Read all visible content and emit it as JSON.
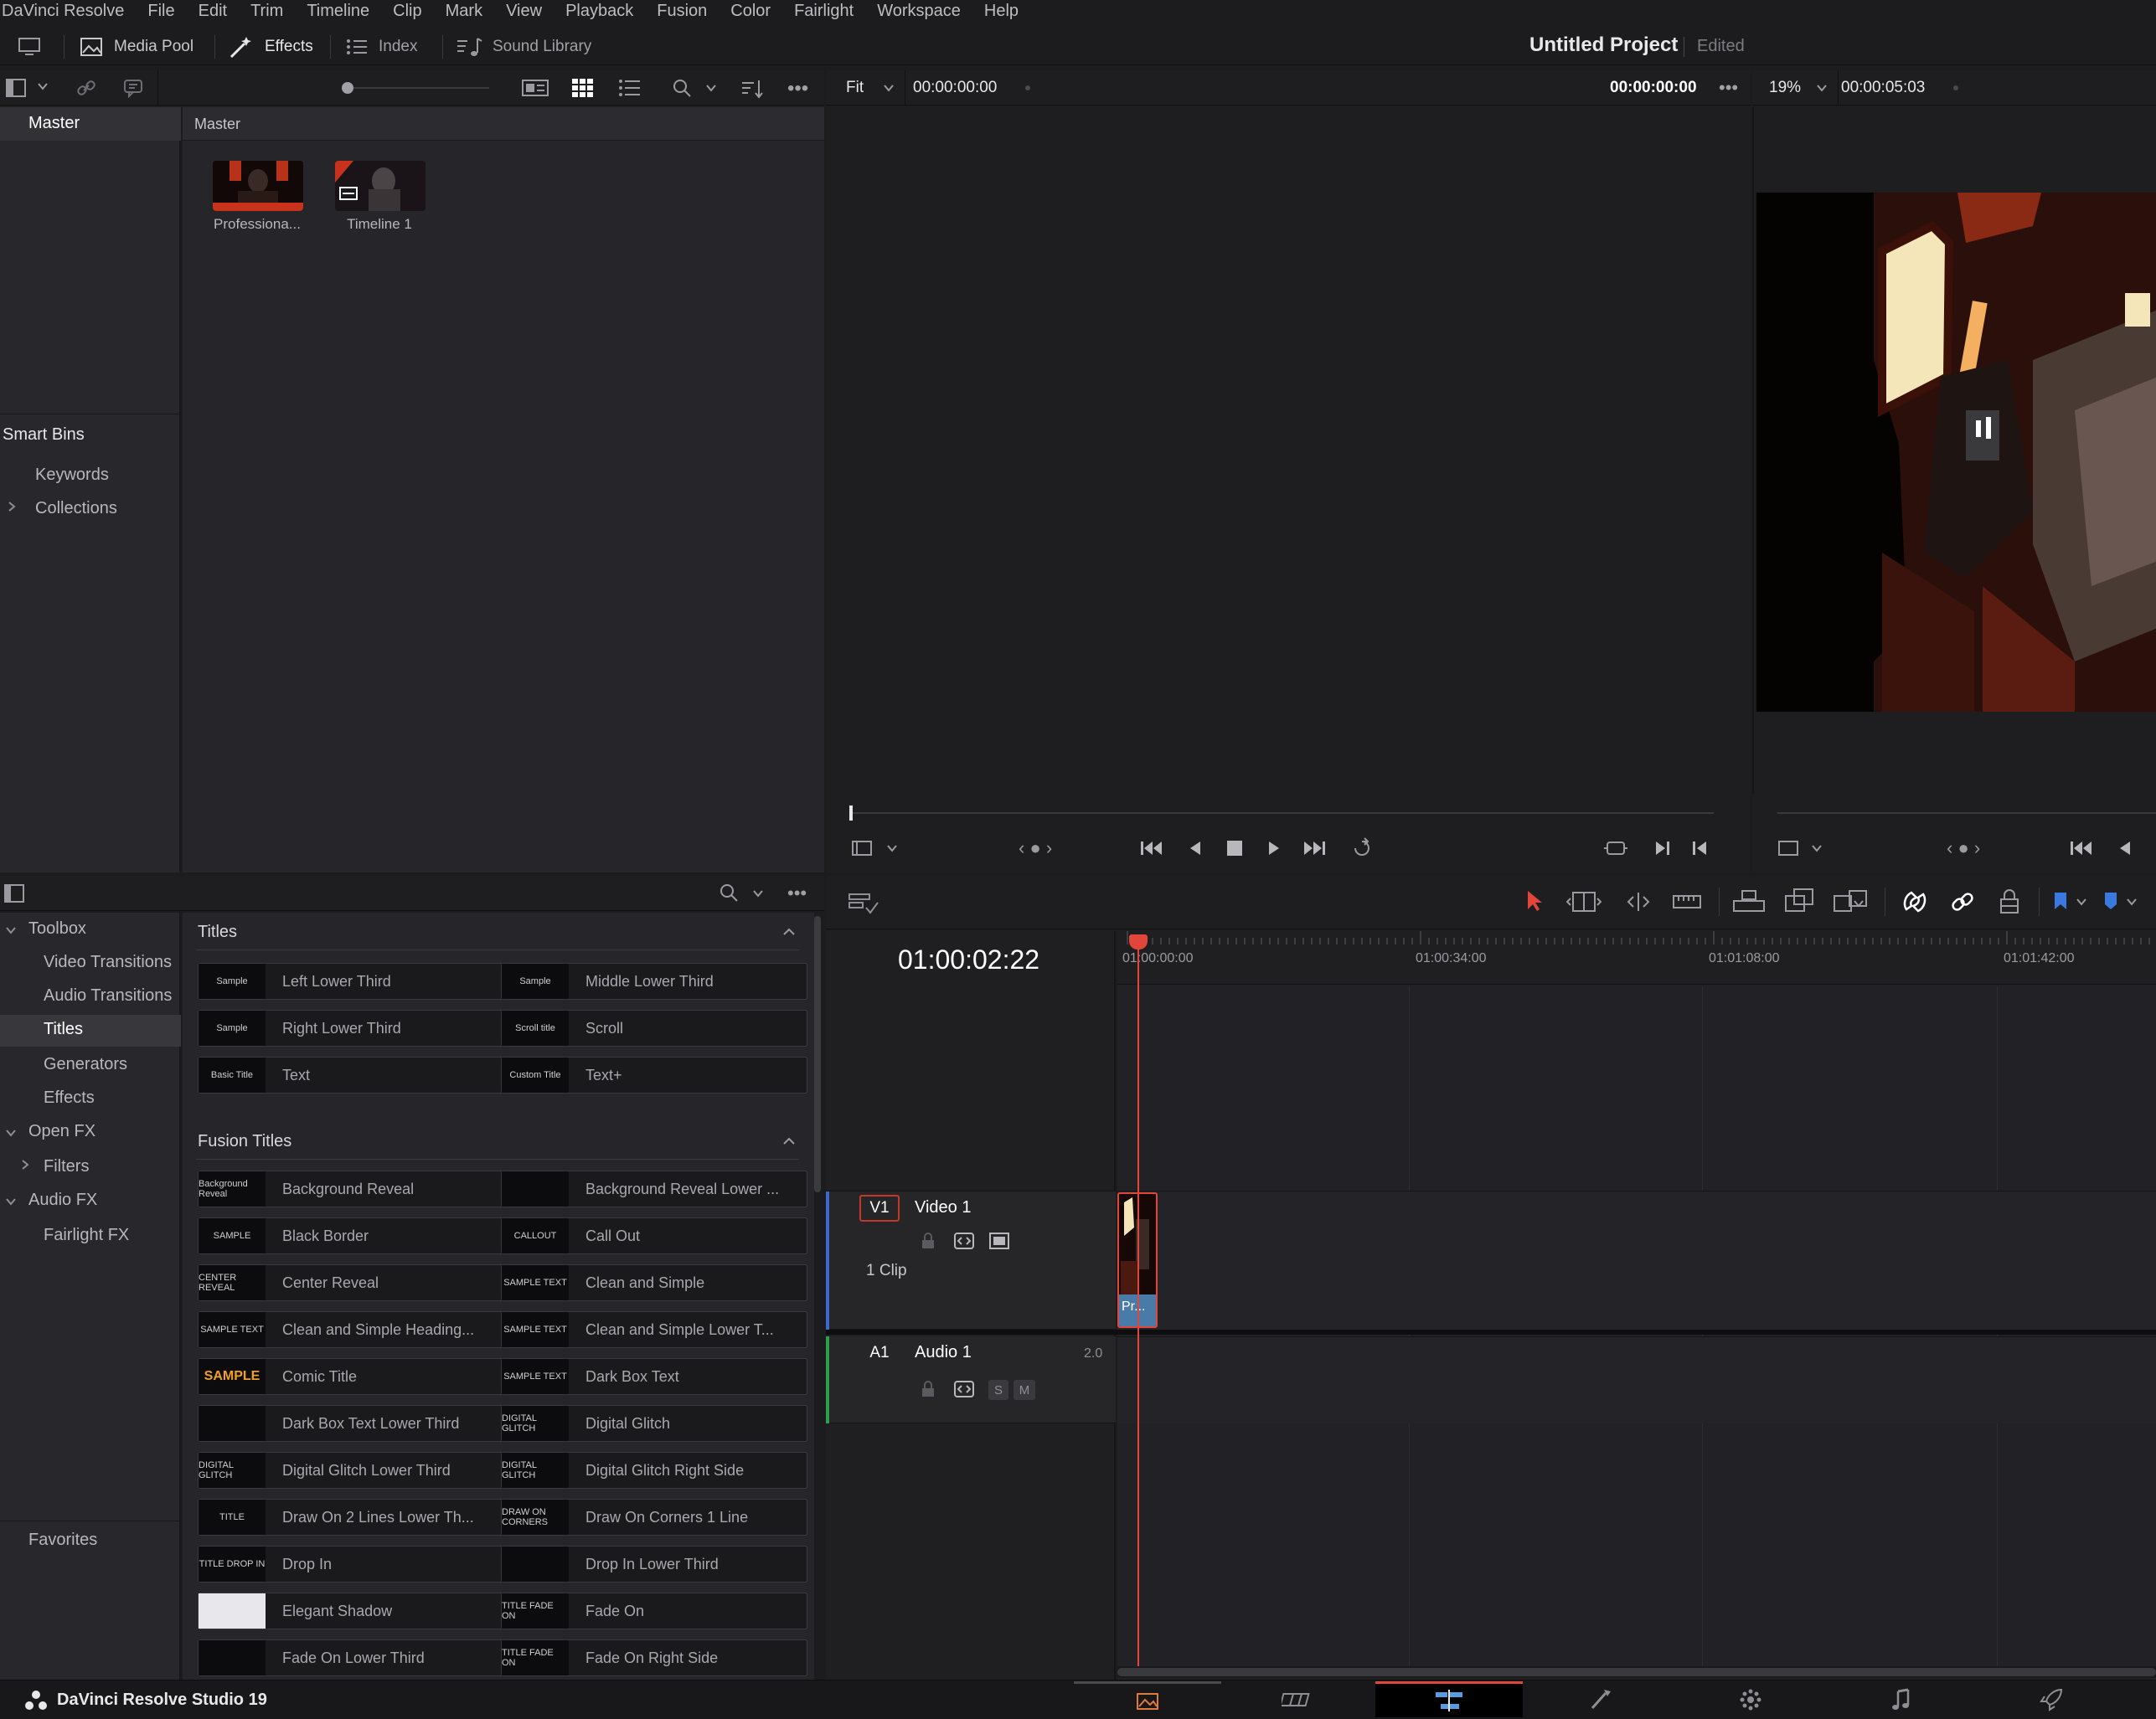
{
  "menubar": {
    "items": [
      "DaVinci Resolve",
      "File",
      "Edit",
      "Trim",
      "Timeline",
      "Clip",
      "Mark",
      "View",
      "Playback",
      "Fusion",
      "Color",
      "Fairlight",
      "Workspace",
      "Help"
    ]
  },
  "toolbar": {
    "media_pool": "Media Pool",
    "effects": "Effects",
    "index": "Index",
    "sound_library": "Sound Library"
  },
  "project": {
    "title": "Untitled Project",
    "status": "Edited"
  },
  "media_pool": {
    "bin_master": "Master",
    "grid_header": "Master",
    "smart_bins": "Smart Bins",
    "keywords": "Keywords",
    "collections": "Collections",
    "clips": [
      {
        "label": "Professiona..."
      },
      {
        "label": "Timeline 1"
      }
    ]
  },
  "source_viewer": {
    "zoom": "Fit",
    "timecode_left": "00:00:00:00",
    "timecode_right": "00:00:00:00"
  },
  "program_viewer": {
    "zoom": "19%",
    "timecode": "00:00:05:03"
  },
  "effects_library": {
    "tree": {
      "toolbox": "Toolbox",
      "video_transitions": "Video Transitions",
      "audio_transitions": "Audio Transitions",
      "titles": "Titles",
      "generators": "Generators",
      "effects": "Effects",
      "open_fx": "Open FX",
      "filters": "Filters",
      "audio_fx": "Audio FX",
      "fairlight_fx": "Fairlight FX",
      "favorites": "Favorites"
    },
    "titles_section": "Titles",
    "titles": [
      {
        "name": "Left Lower Third",
        "thumb": "Sample"
      },
      {
        "name": "Middle Lower Third",
        "thumb": "Sample"
      },
      {
        "name": "Right Lower Third",
        "thumb": "Sample"
      },
      {
        "name": "Scroll",
        "thumb": "Scroll title"
      },
      {
        "name": "Text",
        "thumb": "Basic Title"
      },
      {
        "name": "Text+",
        "thumb": "Custom Title"
      }
    ],
    "fusion_section": "Fusion Titles",
    "fusion_titles": [
      {
        "name": "Background Reveal",
        "thumb": "Background Reveal"
      },
      {
        "name": "Background Reveal Lower ...",
        "thumb": ""
      },
      {
        "name": "Black Border",
        "thumb": "SAMPLE"
      },
      {
        "name": "Call Out",
        "thumb": "CALLOUT"
      },
      {
        "name": "Center Reveal",
        "thumb": "CENTER REVEAL"
      },
      {
        "name": "Clean and Simple",
        "thumb": "SAMPLE TEXT"
      },
      {
        "name": "Clean and Simple Heading...",
        "thumb": "SAMPLE TEXT"
      },
      {
        "name": "Clean and Simple Lower T...",
        "thumb": "SAMPLE TEXT"
      },
      {
        "name": "Comic Title",
        "thumb": "SAMPLE"
      },
      {
        "name": "Dark Box Text",
        "thumb": "SAMPLE TEXT"
      },
      {
        "name": "Dark Box Text Lower Third",
        "thumb": ""
      },
      {
        "name": "Digital Glitch",
        "thumb": "DIGITAL GLITCH"
      },
      {
        "name": "Digital Glitch Lower Third",
        "thumb": "DIGITAL GLITCH"
      },
      {
        "name": "Digital Glitch Right Side",
        "thumb": "DIGITAL GLITCH"
      },
      {
        "name": "Draw On 2 Lines Lower Th...",
        "thumb": "TITLE"
      },
      {
        "name": "Draw On Corners 1 Line",
        "thumb": "DRAW ON CORNERS"
      },
      {
        "name": "Drop In",
        "thumb": "TITLE DROP IN"
      },
      {
        "name": "Drop In Lower Third",
        "thumb": ""
      },
      {
        "name": "Elegant Shadow",
        "thumb": ""
      },
      {
        "name": "Fade On",
        "thumb": "TITLE FADE ON"
      },
      {
        "name": "Fade On Lower Third",
        "thumb": ""
      },
      {
        "name": "Fade On Right Side",
        "thumb": "TITLE FADE ON"
      }
    ]
  },
  "timeline": {
    "timecode": "01:00:02:22",
    "ruler": [
      "01:00:00:00",
      "01:00:34:00",
      "01:01:08:00",
      "01:01:42:00"
    ],
    "video_track": {
      "id": "V1",
      "name": "Video 1",
      "clips": "1 Clip",
      "clip_label": "Pr..."
    },
    "audio_track": {
      "id": "A1",
      "name": "Audio 1",
      "channels": "2.0",
      "solo": "S",
      "mute": "M"
    }
  },
  "footer": {
    "app_name": "DaVinci Resolve Studio 19"
  },
  "colors": {
    "accent": "#e0463a",
    "background": "#1c1c1e",
    "clip_blue": "#4a7aa8"
  }
}
